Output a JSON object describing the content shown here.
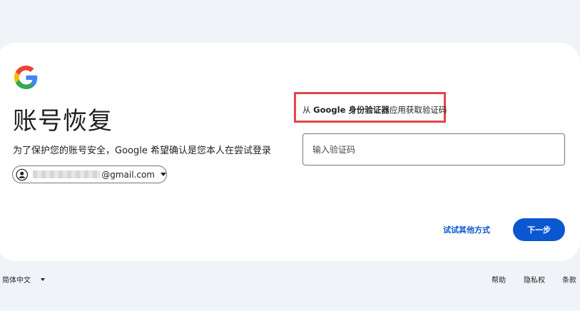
{
  "page": {
    "title": "账号恢复",
    "subtitle": "为了保护您的账号安全，Google 希望确认是您本人在尝试登录"
  },
  "account": {
    "email_domain": "@gmail.com"
  },
  "verification": {
    "instruction_prefix": "从 ",
    "instruction_app": "Google 身份验证器",
    "instruction_suffix": "应用获取验证码",
    "code_placeholder": "输入验证码",
    "code_value": ""
  },
  "actions": {
    "try_other_label": "试试其他方式",
    "next_label": "下一步"
  },
  "footer": {
    "language": "简体中文",
    "help": "帮助",
    "privacy": "隐私权",
    "terms": "条款"
  },
  "colors": {
    "primary_blue": "#0b57d0",
    "highlight_red": "#e0474c",
    "background": "#f0f4f9"
  },
  "icons": {
    "logo": "google-g-logo",
    "avatar": "account-circle-icon",
    "dropdown": "chevron-down-icon"
  }
}
